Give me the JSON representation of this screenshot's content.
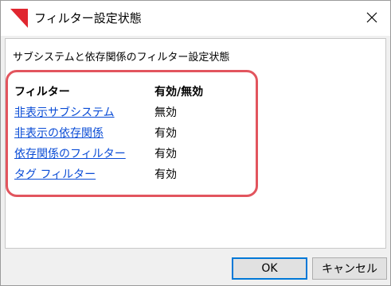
{
  "window": {
    "title": "フィルター設定状態",
    "icon": "red-triangle-icon",
    "close_icon": "close-icon"
  },
  "content": {
    "description": "サブシステムと依存関係のフィルター設定状態",
    "highlight_color": "#e2555e",
    "table": {
      "headers": {
        "filter": "フィルター",
        "state": "有効/無効"
      },
      "rows": [
        {
          "filter": "非表示サブシステム",
          "state": "無効"
        },
        {
          "filter": "非表示の依存関係",
          "state": "有効"
        },
        {
          "filter": "依存関係のフィルター",
          "state": "有効"
        },
        {
          "filter": "タグ フィルター",
          "state": "有効"
        }
      ]
    }
  },
  "buttons": {
    "ok": "OK",
    "cancel": "キャンセル"
  },
  "colors": {
    "link": "#0a4cd6",
    "icon_red": "#e0262f",
    "default_button_border": "#0078d7"
  }
}
